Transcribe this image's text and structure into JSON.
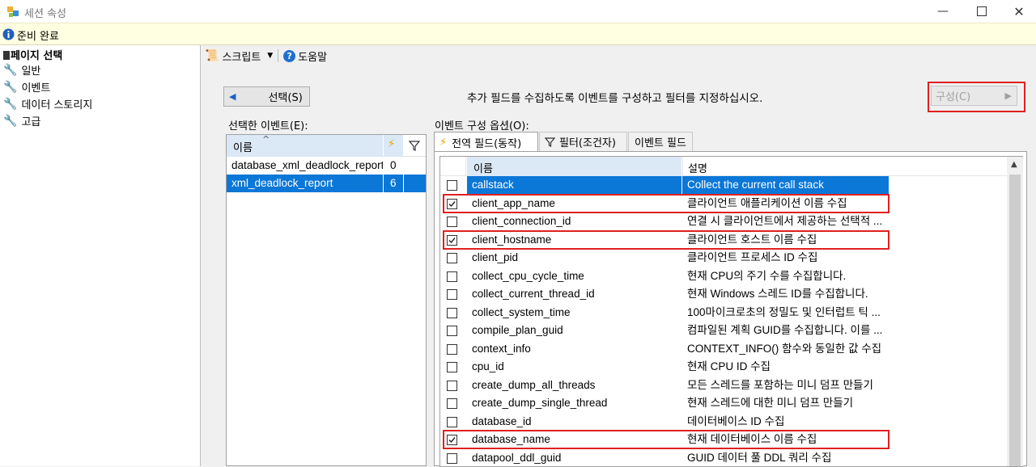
{
  "window": {
    "title": "세션 속성"
  },
  "status": {
    "text": "준비 완료"
  },
  "sidebar": {
    "header": "페이지 선택",
    "items": [
      {
        "label": "일반"
      },
      {
        "label": "이벤트"
      },
      {
        "label": "데이터 스토리지"
      },
      {
        "label": "고급"
      }
    ]
  },
  "toolbar": {
    "script_label": "스크립트",
    "help_label": "도움말"
  },
  "main": {
    "select_button": "선택(S)",
    "instruction": "추가 필드를 수집하도록 이벤트를 구성하고 필터를 지정하십시오.",
    "configure_button": "구성(C)",
    "selected_events_label": "선택한 이벤트(E):",
    "config_options_label": "이벤트 구성 옵션(O):"
  },
  "events_table": {
    "header_name": "이름",
    "rows": [
      {
        "name": "database_xml_deadlock_report",
        "count": "0",
        "selected": false
      },
      {
        "name": "xml_deadlock_report",
        "count": "6",
        "selected": true
      }
    ]
  },
  "tabs": [
    {
      "label": "전역 필드(동작)",
      "active": true
    },
    {
      "label": "필터(조건자)",
      "active": false
    },
    {
      "label": "이벤트 필드",
      "active": false
    }
  ],
  "fields_table": {
    "header_name": "이름",
    "header_desc": "설명",
    "rows": [
      {
        "name": "callstack",
        "desc": "Collect the current call stack",
        "checked": false,
        "selected": true
      },
      {
        "name": "client_app_name",
        "desc": "클라이언트 애플리케이션 이름 수집",
        "checked": true,
        "highlight": true
      },
      {
        "name": "client_connection_id",
        "desc": "연결 시 클라이언트에서 제공하는 선택적 ...",
        "checked": false
      },
      {
        "name": "client_hostname",
        "desc": "클라이언트 호스트 이름 수집",
        "checked": true,
        "highlight": true
      },
      {
        "name": "client_pid",
        "desc": "클라이언트 프로세스 ID 수집",
        "checked": false
      },
      {
        "name": "collect_cpu_cycle_time",
        "desc": "현재 CPU의 주기 수를 수집합니다.",
        "checked": false
      },
      {
        "name": "collect_current_thread_id",
        "desc": "현재 Windows 스레드 ID를 수집합니다.",
        "checked": false
      },
      {
        "name": "collect_system_time",
        "desc": "100마이크로초의 정밀도 및 인터럽트 틱 ...",
        "checked": false
      },
      {
        "name": "compile_plan_guid",
        "desc": "컴파일된 계획 GUID를 수집합니다. 이를 ...",
        "checked": false
      },
      {
        "name": "context_info",
        "desc": "CONTEXT_INFO() 함수와 동일한 값 수집",
        "checked": false
      },
      {
        "name": "cpu_id",
        "desc": "현재 CPU ID 수집",
        "checked": false
      },
      {
        "name": "create_dump_all_threads",
        "desc": "모든 스레드를 포함하는 미니 덤프 만들기",
        "checked": false
      },
      {
        "name": "create_dump_single_thread",
        "desc": "현재 스레드에 대한 미니 덤프 만들기",
        "checked": false
      },
      {
        "name": "database_id",
        "desc": "데이터베이스 ID 수집",
        "checked": false
      },
      {
        "name": "database_name",
        "desc": "현재 데이터베이스 이름 수집",
        "checked": true,
        "highlight": true
      },
      {
        "name": "datapool_ddl_guid",
        "desc": "GUID 데이터 풀 DDL 쿼리 수집",
        "checked": false
      }
    ]
  }
}
